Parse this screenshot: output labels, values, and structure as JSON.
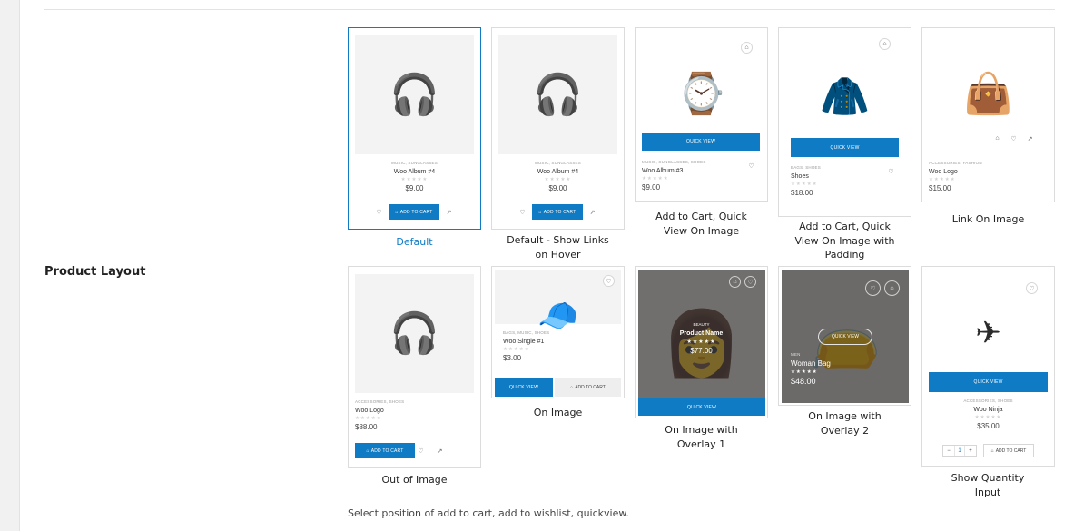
{
  "setting": {
    "label": "Product Layout",
    "help": "Select position of add to cart, add to wishlist, quickview."
  },
  "colors": {
    "accent": "#0e7bc4",
    "border": "#dcdcdc"
  },
  "options": [
    {
      "caption": "Default",
      "selected": true,
      "product": {
        "categories": "Music, Sunglasses",
        "name": "Woo Album #4",
        "price": "$9.00",
        "image": "headphones-icon"
      },
      "add_to_cart": "Add to cart"
    },
    {
      "caption": "Default - Show Links on Hover",
      "selected": false,
      "product": {
        "categories": "Music, Sunglasses",
        "name": "Woo Album #4",
        "price": "$9.00",
        "image": "headphones-icon"
      },
      "add_to_cart": "Add to cart"
    },
    {
      "caption": "Add to Cart, Quick View On Image",
      "selected": false,
      "product": {
        "categories": "Music, Sunglasses, Shoes",
        "name": "Woo Album #3",
        "price": "$9.00",
        "image": "watch-icon"
      },
      "quick_view": "Quick View"
    },
    {
      "caption": "Add to Cart, Quick View On Image with Padding",
      "selected": false,
      "product": {
        "categories": "Bags, Shoes",
        "name": "Shoes",
        "price": "$18.00",
        "image": "jacket-icon"
      },
      "quick_view": "Quick View"
    },
    {
      "caption": "Link On Image",
      "selected": false,
      "product": {
        "categories": "Accessories, Fashion",
        "name": "Woo Logo",
        "price": "$15.00",
        "image": "handbag-icon"
      }
    },
    {
      "caption": "Out of Image",
      "selected": false,
      "product": {
        "categories": "Accessories, Shoes",
        "name": "Woo Logo",
        "price": "$88.00",
        "image": "headphones-icon"
      },
      "add_to_cart": "Add to cart"
    },
    {
      "caption": "On Image",
      "selected": false,
      "product": {
        "categories": "Bags, Music, Shoes",
        "name": "Woo Single #1",
        "price": "$3.00",
        "image": "cap-icon"
      },
      "quick_view": "Quick View",
      "add_to_cart": "Add to cart"
    },
    {
      "caption": "On Image with Overlay 1",
      "selected": false,
      "product": {
        "categories": "Beauty",
        "name": "Product Name",
        "price": "$77.00",
        "image": "woman-icon"
      },
      "quick_view": "Quick View"
    },
    {
      "caption": "On Image with Overlay 2",
      "selected": false,
      "product": {
        "categories": "Men",
        "name": "Woman Bag",
        "price": "$48.00",
        "image": "bag-icon"
      },
      "quick_view": "Quick View"
    },
    {
      "caption": "Show Quantity Input",
      "selected": false,
      "product": {
        "categories": "Accessories, Shoes",
        "name": "Woo Ninja",
        "price": "$35.00",
        "image": "drone-icon"
      },
      "quick_view": "Quick View",
      "add_to_cart": "Add to cart",
      "qty": "1"
    }
  ]
}
